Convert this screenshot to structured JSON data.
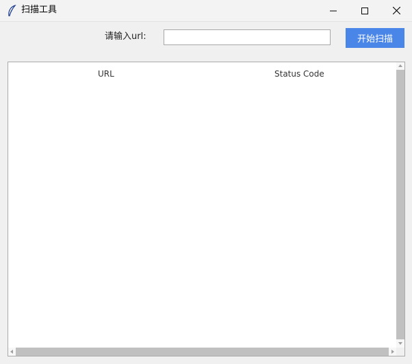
{
  "window": {
    "title": "扫描工具",
    "icons": {
      "app": "feather-icon",
      "minimize": "minimize-icon",
      "maximize": "maximize-icon",
      "close": "close-icon"
    }
  },
  "form": {
    "url_label": "请输入url:",
    "url_value": "",
    "scan_button_label": "开始扫描"
  },
  "results_table": {
    "columns": [
      "URL",
      "Status Code"
    ],
    "rows": []
  },
  "colors": {
    "accent": "#4a86e8",
    "window_bg": "#f0f0f0",
    "scroll_thumb": "#c0c0c0"
  }
}
